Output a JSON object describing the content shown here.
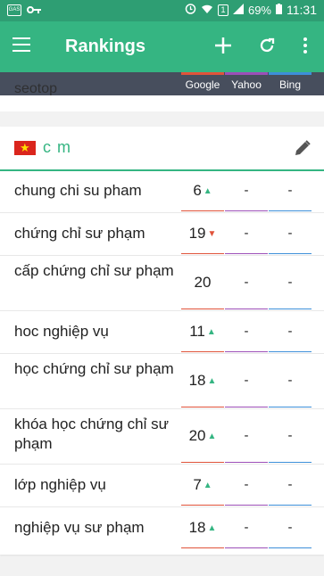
{
  "status": {
    "battery": "69%",
    "time": "11:31"
  },
  "appbar": {
    "title": "Rankings"
  },
  "site": {
    "name": "seotop"
  },
  "engines": [
    {
      "name": "Google",
      "color": "#e0533a"
    },
    {
      "name": "Yahoo",
      "color": "#9c4fb8"
    },
    {
      "name": "Bing",
      "color": "#3d8fd9"
    }
  ],
  "keyword_group": {
    "title": "c                  m"
  },
  "rows": [
    {
      "keyword": "chung chi su pham",
      "google": "6",
      "trend": "up",
      "yahoo": "-",
      "bing": "-"
    },
    {
      "keyword": "chứng chỉ sư phạm",
      "google": "19",
      "trend": "down",
      "yahoo": "-",
      "bing": "-"
    },
    {
      "keyword": "cấp chứng chỉ sư phạm",
      "google": "20",
      "trend": "",
      "yahoo": "-",
      "bing": "-"
    },
    {
      "keyword": "hoc nghiệp vụ",
      "google": "11",
      "trend": "up",
      "yahoo": "-",
      "bing": "-"
    },
    {
      "keyword": "học chứng chỉ sư phạm",
      "google": "18",
      "trend": "up",
      "yahoo": "-",
      "bing": "-"
    },
    {
      "keyword": "khóa học chứng chỉ sư phạm",
      "google": "20",
      "trend": "up",
      "yahoo": "-",
      "bing": "-"
    },
    {
      "keyword": "lớp nghiệp vụ",
      "google": "7",
      "trend": "up",
      "yahoo": "-",
      "bing": "-"
    },
    {
      "keyword": "nghiệp vụ sư phạm",
      "google": "18",
      "trend": "up",
      "yahoo": "-",
      "bing": "-"
    }
  ]
}
